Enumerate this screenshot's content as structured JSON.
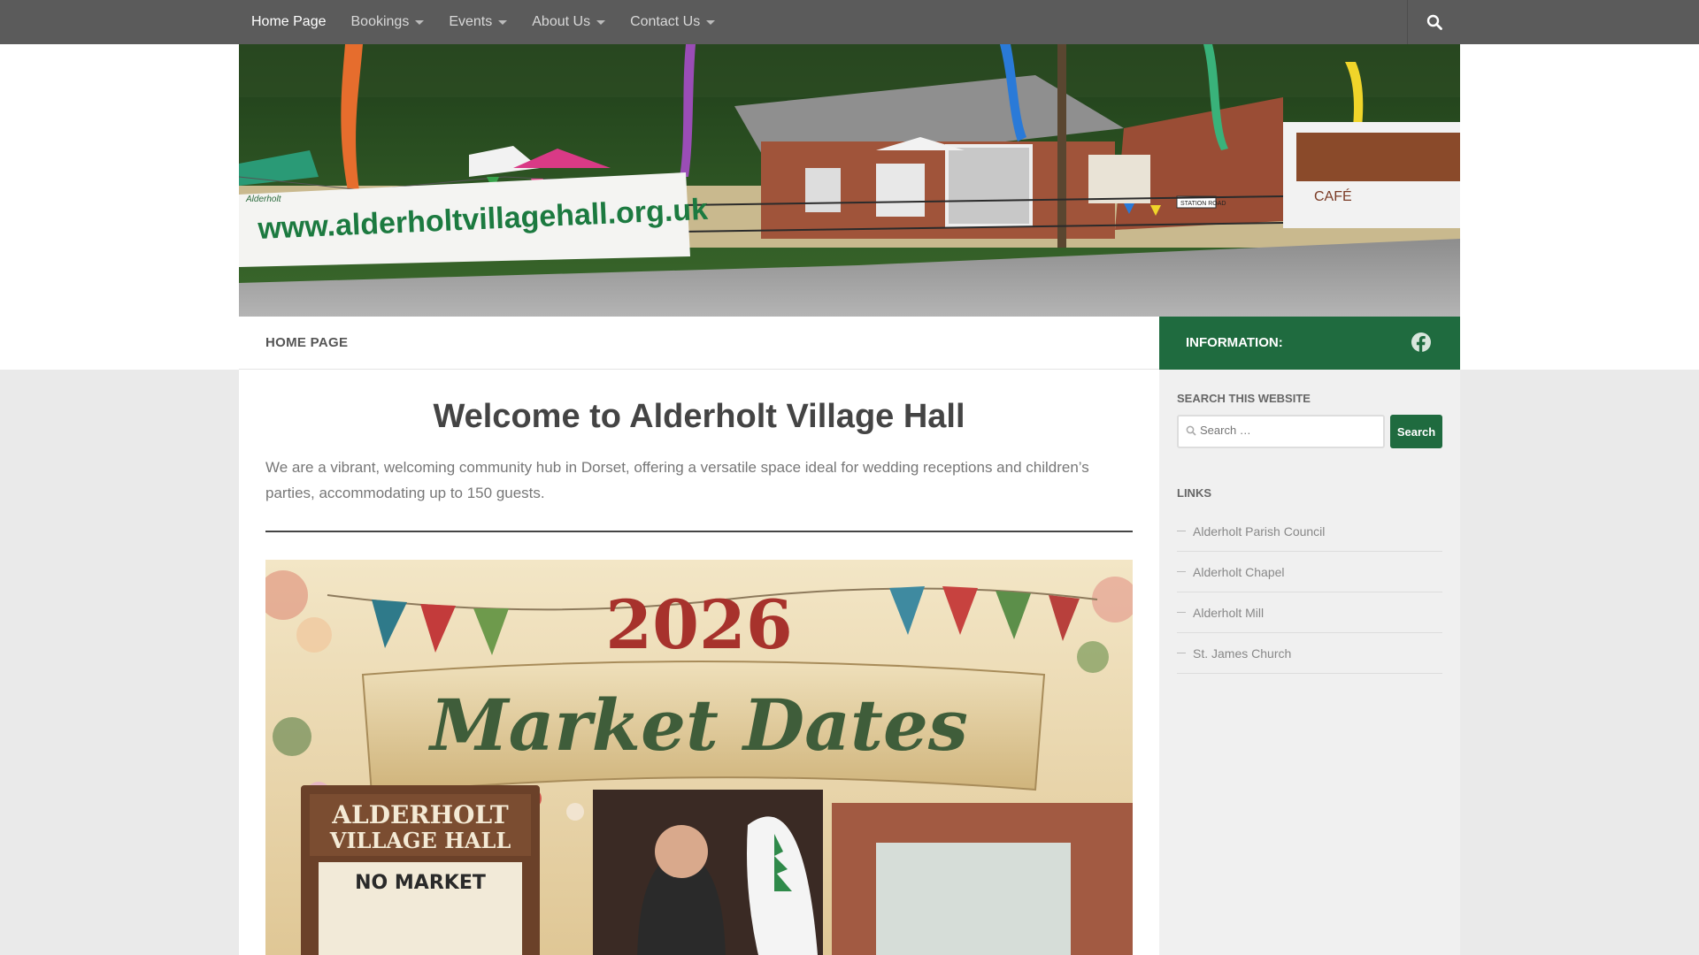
{
  "nav": {
    "items": [
      {
        "label": "Home Page",
        "has_dropdown": false,
        "active": true
      },
      {
        "label": "Bookings",
        "has_dropdown": true
      },
      {
        "label": "Events",
        "has_dropdown": true
      },
      {
        "label": "About Us",
        "has_dropdown": true
      },
      {
        "label": "Contact Us",
        "has_dropdown": true
      }
    ],
    "search_icon": "search-icon"
  },
  "header": {
    "banner_text": "www.alderholtvillagehall.org.uk",
    "banner_small_text": "Alderholt",
    "road_sign": "STATION ROAD",
    "van_sign": "CAFÉ"
  },
  "subheader": {
    "title": "HOME PAGE"
  },
  "info_bar": {
    "title": "INFORMATION:",
    "icon": "facebook-icon"
  },
  "main": {
    "title": "Welcome to Alderholt Village Hall",
    "intro": "We are a vibrant, welcoming community hub in Dorset, offering a versatile space ideal for wedding receptions and children’s parties, accommodating up to 150 guests.",
    "poster": {
      "year": "2026",
      "heading": "Market Dates",
      "sign_line1": "ALDERHOLT",
      "sign_line2": "VILLAGE HALL",
      "sign_line3": "NO MARKET"
    }
  },
  "sidebar": {
    "search_title": "Search this website",
    "search_placeholder": "Search …",
    "search_button": "Search",
    "links_title": "Links",
    "links": [
      "Alderholt Parish Council",
      "Alderholt Chapel",
      "Alderholt Mill",
      "St. James Church"
    ]
  },
  "colors": {
    "topbar": "#5b5b5b",
    "accent_green": "#1f6b3f",
    "page_bg": "#eaeaea"
  }
}
